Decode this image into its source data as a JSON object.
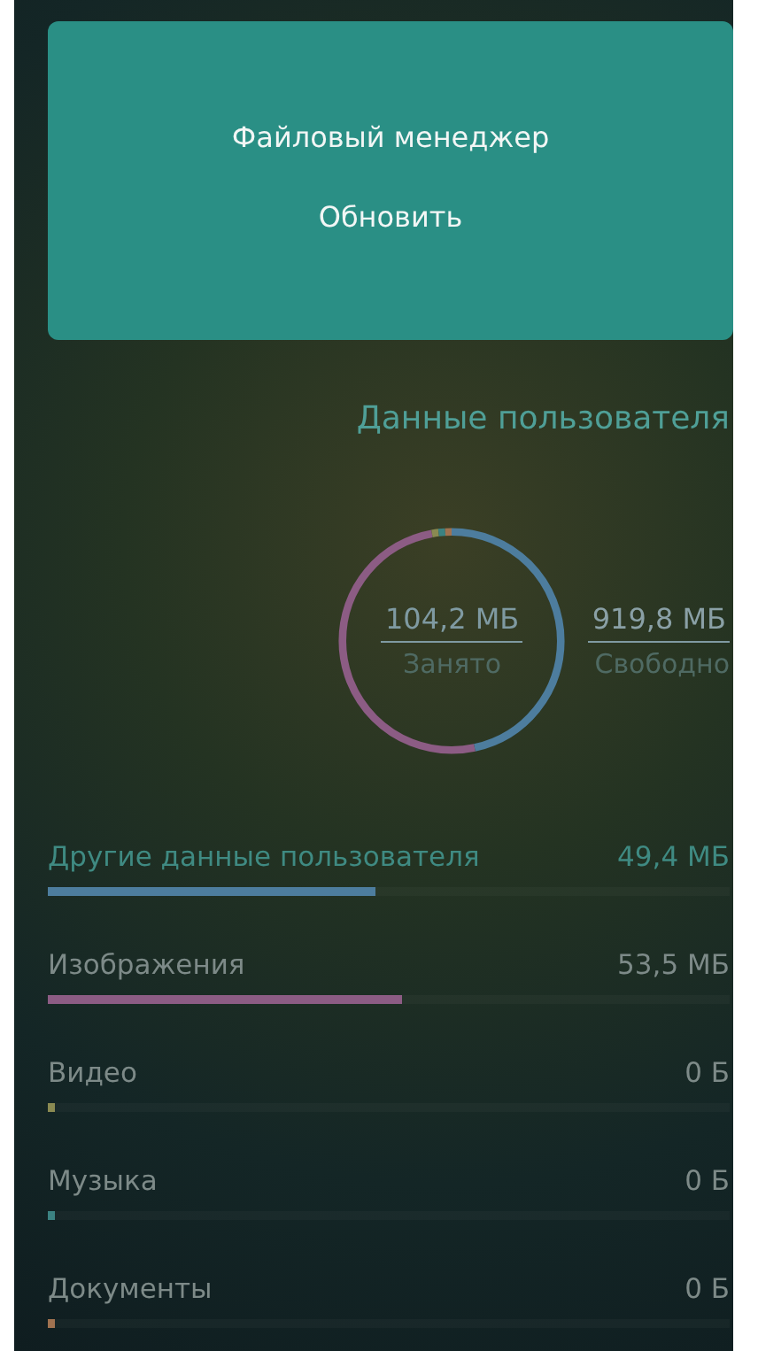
{
  "header_card": {
    "title": "Файловый менеджер",
    "refresh_button": "Обновить"
  },
  "section_title": "Данные пользователя",
  "usage": {
    "used_value": "104,2 МБ",
    "used_label": "Занято",
    "free_value": "919,8 МБ",
    "free_label": "Свободно"
  },
  "categories": [
    {
      "name": "Другие данные пользователя",
      "size": "49,4 МБ",
      "level": 0.48,
      "color": "#4d7d9e"
    },
    {
      "name": "Изображения",
      "size": "53,5 МБ",
      "level": 0.52,
      "color": "#8c5c84"
    },
    {
      "name": "Видео",
      "size": "0 Б",
      "level": 0.01,
      "color": "#8a8a52"
    },
    {
      "name": "Музыка",
      "size": "0 Б",
      "level": 0.01,
      "color": "#3b8282"
    },
    {
      "name": "Документы",
      "size": "0 Б",
      "level": 0.01,
      "color": "#a07250"
    }
  ]
}
